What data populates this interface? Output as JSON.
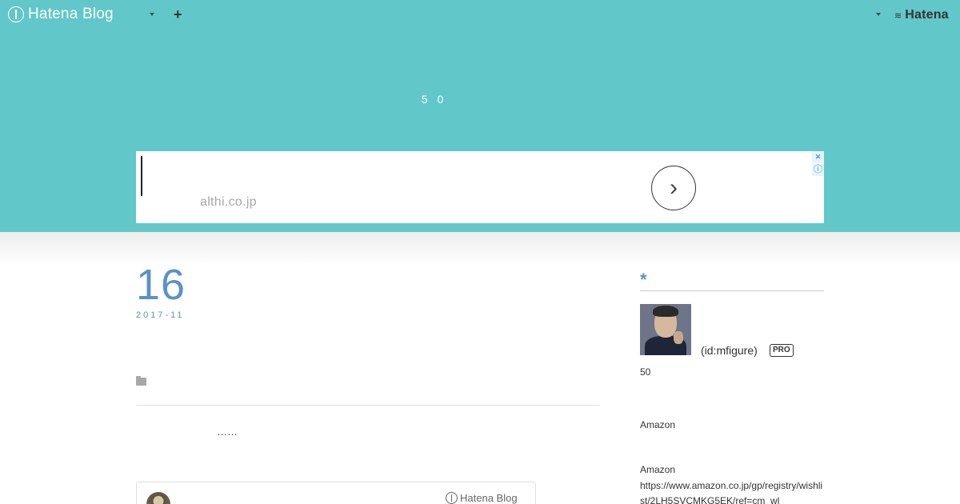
{
  "topbar": {
    "brand": "Hatena Blog",
    "add_symbol": "+",
    "hatena_label": "Hatena"
  },
  "header": {
    "title": "5 0"
  },
  "ad": {
    "domain": "althi.co.jp",
    "arrow": "›",
    "close": "×",
    "info": "ⓘ"
  },
  "entry": {
    "day": "16",
    "year_month": "2017-11",
    "excerpt": "……"
  },
  "embed": {
    "brand": "Hatena Blog"
  },
  "sidebar": {
    "heading": "*",
    "user_id": "(id:mfigure)",
    "badge": "PRO",
    "text_50": "50",
    "amazon_1": "Amazon",
    "amazon_2": "Amazon",
    "url": "https://www.amazon.co.jp/gp/registry/wishlist/2LH5SVCMKG5EK/ref=cm_wl_"
  },
  "colors": {
    "header_bg": "#62c7c8",
    "accent": "#5a91c8"
  }
}
